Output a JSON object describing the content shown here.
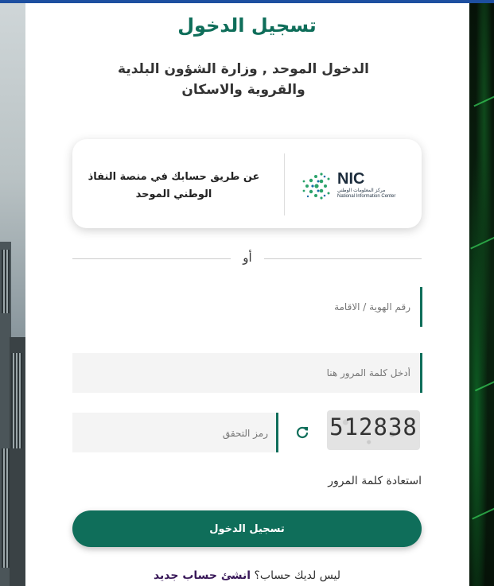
{
  "page": {
    "title": "تسجيل الدخول",
    "subtitle": "الدخول الموحد , وزارة الشؤون البلدية والقروية والاسكان"
  },
  "nafath": {
    "text": "عن طريق حسابك في منصة النفاذ الوطني الموحد",
    "logo_name": "NIC",
    "logo_ar": "مركز المعلومات الوطني",
    "logo_en": "National Information Center"
  },
  "or_text": "أو",
  "form": {
    "id_placeholder": "رقم الهوية / الاقامة",
    "password_placeholder": "أدخل كلمة المرور هنا",
    "captcha_placeholder": "رمز التحقق",
    "captcha_code": "512838",
    "refresh_icon": "refresh-icon",
    "forgot_password": "استعادة كلمة المرور",
    "login_button": "تسجيل الدخول"
  },
  "signup": {
    "question": "ليس لديك حساب؟",
    "link": "انشئ حساب جديد"
  },
  "colors": {
    "primary": "#0f6e5a",
    "top_bar": "#1d4fa0",
    "signup_link": "#3a1a5a"
  }
}
